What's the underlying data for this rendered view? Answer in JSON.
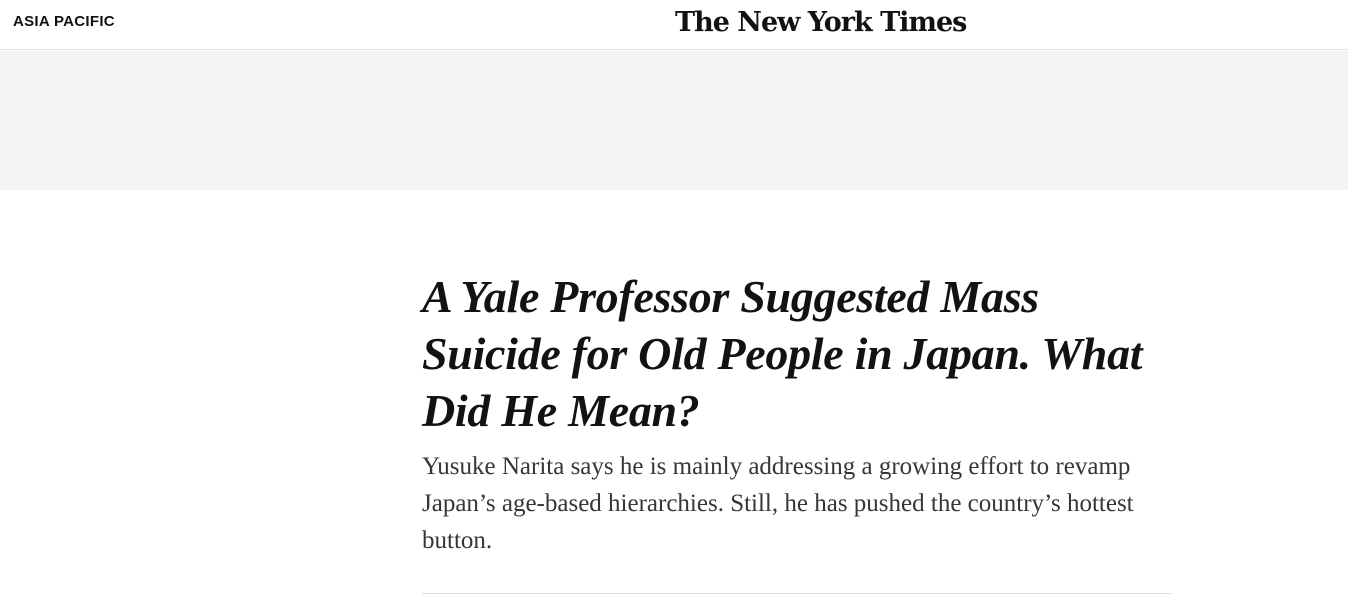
{
  "header": {
    "section_label": "ASIA PACIFIC",
    "logo_text": "The New York Times"
  },
  "article": {
    "headline": "A Yale Professor Suggested Mass Suicide for Old People in Japan. What Did He Mean?",
    "summary": "Yusuke Narita says he is mainly addressing a growing effort to revamp Japan’s age-based hierarchies. Still, he has pushed the country’s hottest button."
  },
  "colors": {
    "ad_background": "#f5f5f5",
    "text": "#121212",
    "summary_text": "#363636",
    "divider": "#dfdfdf"
  }
}
